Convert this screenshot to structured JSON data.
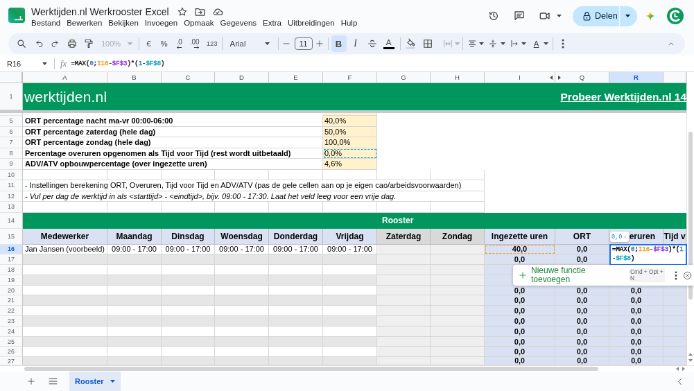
{
  "app": {
    "title": "Werktijden.nl Werkrooster Excel",
    "menu": [
      "Bestand",
      "Bewerken",
      "Bekijken",
      "Invoegen",
      "Opmaak",
      "Gegevens",
      "Extra",
      "Uitbreidingen",
      "Hulp"
    ],
    "share_button": "Delen"
  },
  "toolbar": {
    "zoom": {
      "value": "100%",
      "disabled": true
    },
    "number_formats": [
      {
        "kind": "currency",
        "label": "€"
      },
      {
        "kind": "percent",
        "label": "%"
      },
      {
        "kind": "decrease_decimals",
        "label": ".0"
      },
      {
        "kind": "increase_decimals",
        "label": ".00"
      },
      {
        "kind": "more_formats",
        "label": "123"
      }
    ],
    "font": "Arial",
    "font_size": "11",
    "styles": [
      {
        "kind": "bold",
        "label": "B",
        "on": true
      },
      {
        "kind": "italic",
        "label": "I",
        "on": false
      }
    ],
    "text_color": {
      "label": "A"
    },
    "merge": {
      "disabled": true
    },
    "rotation": {
      "label": "A"
    }
  },
  "formula_bar": {
    "cell": "R16",
    "fx": "fx",
    "formula": [
      {
        "text": "=MAX("
      },
      {
        "text": "0",
        "color": "#3c78d8"
      },
      {
        "text": ";"
      },
      {
        "text": "I16",
        "color": "#f29b26"
      },
      {
        "text": "-"
      },
      {
        "text": "$F$3",
        "color": "#9334e6"
      },
      {
        "text": ")*("
      },
      {
        "text": "1",
        "color": "#3c78d8"
      },
      {
        "text": "-"
      },
      {
        "text": "$F$8",
        "color": "#12a5c9"
      },
      {
        "text": ")"
      }
    ]
  },
  "sheet": {
    "columns": [
      {
        "label": "A",
        "selected": false,
        "hidden_after": false
      },
      {
        "label": "B",
        "selected": false,
        "hidden_after": false
      },
      {
        "label": "C",
        "selected": false,
        "hidden_after": false
      },
      {
        "label": "D",
        "selected": false,
        "hidden_after": false
      },
      {
        "label": "E",
        "selected": false,
        "hidden_after": false
      },
      {
        "label": "F",
        "selected": false,
        "hidden_after": false
      },
      {
        "label": "G",
        "selected": false,
        "hidden_after": false
      },
      {
        "label": "H",
        "selected": false,
        "hidden_after": false
      },
      {
        "label": "I",
        "selected": false,
        "hidden_after": true
      },
      {
        "label": "Q",
        "selected": false,
        "hidden_after": false
      },
      {
        "label": "R",
        "selected": true,
        "hidden_after": false
      },
      {
        "selected": false,
        "hidden_after": false
      }
    ],
    "rows": [
      {
        "kind": "banner",
        "row": "1",
        "selected": false,
        "logo": "werktijden.nl",
        "link": "Probeer Werktijden.nl 14"
      },
      {
        "kind": "partial",
        "selected": false
      },
      {
        "kind": "setting",
        "row": "5",
        "selected": false,
        "label": "ORT percentage nacht ma-vr 00:00-06:00",
        "value": "40,0%"
      },
      {
        "kind": "setting",
        "row": "6",
        "selected": false,
        "label": "ORT percentage zaterdag (hele dag)",
        "value": "50,0%"
      },
      {
        "kind": "setting",
        "row": "7",
        "selected": false,
        "label": "ORT percentage zondag (hele dag)",
        "value": "100,0%"
      },
      {
        "kind": "setting",
        "row": "8",
        "selected": false,
        "label": "Percentage overuren opgenomen als Tijd voor Tijd (rest wordt uitbetaald)",
        "value": "0,0%",
        "color": "#12a5c9"
      },
      {
        "kind": "setting",
        "row": "9",
        "selected": false,
        "label": "ADV/ATV opbouwpercentage (over ingezette uren)",
        "value": "4,6%"
      },
      {
        "kind": "blank",
        "row": "10",
        "selected": false
      },
      {
        "kind": "note",
        "row": "11",
        "selected": false,
        "italic": false,
        "text": "- Instellingen berekening ORT, Overuren, Tijd voor Tijd en ADV/ATV (pas de gele cellen aan op je eigen cao/arbeidsvoorwaarden)"
      },
      {
        "kind": "note",
        "row": "12",
        "selected": false,
        "italic": true,
        "text": "- Vul per dag de werktijd in als <starttijd> - <eindtijd>, bijv. 09:00 - 17:30. Laat het veld leeg voor een vrije dag."
      },
      {
        "kind": "blank",
        "row": "13",
        "selected": false
      },
      {
        "kind": "section",
        "row": "14",
        "selected": false,
        "title": "Rooster"
      },
      {
        "kind": "header",
        "row": "15",
        "selected": false,
        "cells": [
          {
            "label": "Medewerker",
            "kind": "input"
          },
          {
            "label": "Maandag",
            "kind": "input"
          },
          {
            "label": "Dinsdag",
            "kind": "input"
          },
          {
            "label": "Woensdag",
            "kind": "input"
          },
          {
            "label": "Donderdag",
            "kind": "input"
          },
          {
            "label": "Vrijdag",
            "kind": "input"
          },
          {
            "label": "Zaterdag",
            "kind": "weekend"
          },
          {
            "label": "Zondag",
            "kind": "weekend"
          },
          {
            "label": "Ingezette uren",
            "kind": "result"
          },
          {
            "label": "ORT",
            "kind": "result"
          },
          {
            "label": "eruren",
            "kind": "result"
          },
          {
            "label": "Tijd v",
            "kind": "result"
          }
        ]
      },
      {
        "kind": "data",
        "row": "16",
        "selected": true,
        "banded": false,
        "name": "Jan Jansen (voorbeeld)",
        "times": [
          "09:00 - 17:00",
          "09:00 - 17:00",
          "09:00 - 17:00",
          "09:00 - 17:00",
          "09:00 - 17:00"
        ],
        "totals": [
          {
            "text": "40,0",
            "color": "#f29b26"
          },
          {
            "text": "0,0"
          }
        ]
      },
      {
        "kind": "data",
        "row": "17",
        "selected": false,
        "banded": true,
        "totals": [
          {
            "text": "0,0"
          },
          {
            "text": "0,0"
          }
        ]
      },
      {
        "kind": "data",
        "row": "18",
        "selected": false,
        "banded": false
      },
      {
        "kind": "data",
        "row": "19",
        "selected": false,
        "banded": true
      },
      {
        "kind": "data",
        "row": "20",
        "selected": false,
        "banded": false,
        "totals": [
          {
            "text": "0,0"
          },
          {
            "text": "0,0"
          },
          {
            "text": "0,0"
          }
        ]
      },
      {
        "kind": "data",
        "row": "21",
        "selected": false,
        "banded": true,
        "totals": [
          {
            "text": "0,0"
          },
          {
            "text": "0,0"
          },
          {
            "text": "0,0"
          }
        ]
      },
      {
        "kind": "data",
        "row": "22",
        "selected": false,
        "banded": false,
        "totals": [
          {
            "text": "0,0"
          },
          {
            "text": "0,0"
          },
          {
            "text": "0,0"
          }
        ]
      },
      {
        "kind": "data",
        "row": "23",
        "selected": false,
        "banded": true,
        "totals": [
          {
            "text": "0,0"
          },
          {
            "text": "0,0"
          },
          {
            "text": "0,0"
          }
        ]
      },
      {
        "kind": "data",
        "row": "24",
        "selected": false,
        "banded": false,
        "totals": [
          {
            "text": "0,0"
          },
          {
            "text": "0,0"
          },
          {
            "text": "0,0"
          }
        ]
      },
      {
        "kind": "data",
        "row": "25",
        "selected": false,
        "banded": true,
        "totals": [
          {
            "text": "0,0"
          },
          {
            "text": "0,0"
          },
          {
            "text": "0,0"
          }
        ]
      },
      {
        "kind": "data",
        "row": "26",
        "selected": false,
        "banded": false,
        "totals": [
          {
            "text": "0,0"
          },
          {
            "text": "0,0"
          },
          {
            "text": "0,0"
          }
        ]
      },
      {
        "kind": "data",
        "row": "27",
        "selected": false,
        "banded": true,
        "totals": [
          {
            "text": "0,0"
          },
          {
            "text": "0,0"
          },
          {
            "text": "0,0"
          }
        ]
      }
    ]
  },
  "cell_editor": {
    "result": "0,0",
    "formula": [
      {
        "text": "=MAX("
      },
      {
        "text": "0",
        "color": "#3c78d8"
      },
      {
        "text": ";"
      },
      {
        "text": "I16",
        "color": "#f29b26"
      },
      {
        "text": "-"
      },
      {
        "text": "$F$3",
        "color": "#9334e6"
      },
      {
        "text": ")*("
      },
      {
        "text": "1",
        "color": "#3c78d8"
      },
      {
        "text": "-"
      },
      {
        "text": "$F$8",
        "color": "#12a5c9"
      },
      {
        "text": ")"
      }
    ]
  },
  "suggestion": {
    "label": "Nieuwe functie toevoegen",
    "shortcut": "Cmd + Opt + N"
  },
  "sheet_tabs": [
    {
      "label": "Rooster",
      "selected": true
    }
  ]
}
